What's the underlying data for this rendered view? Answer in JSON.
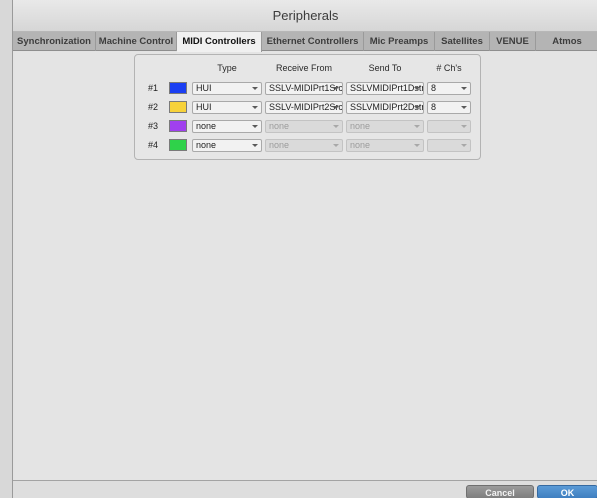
{
  "window": {
    "title": "Peripherals"
  },
  "tabs": [
    {
      "label": "Synchronization"
    },
    {
      "label": "Machine Control"
    },
    {
      "label": "MIDI Controllers"
    },
    {
      "label": "Ethernet Controllers"
    },
    {
      "label": "Mic Preamps"
    },
    {
      "label": "Satellites"
    },
    {
      "label": "VENUE"
    },
    {
      "label": "Atmos"
    }
  ],
  "active_tab": "MIDI Controllers",
  "table": {
    "headers": {
      "type": "Type",
      "receive": "Receive From",
      "send": "Send To",
      "channels": "# Ch's"
    },
    "rows": [
      {
        "num": "#1",
        "color": "#1b3ff2",
        "type": "HUI",
        "receive": "SSLV-MIDIPrt1Src",
        "send": "SSLVMIDIPrt1Dstn",
        "channels": "8"
      },
      {
        "num": "#2",
        "color": "#f7d23a",
        "type": "HUI",
        "receive": "SSLV-MIDIPrt2Src",
        "send": "SSLVMIDIPrt2Dstn",
        "channels": "8"
      },
      {
        "num": "#3",
        "color": "#a040ee",
        "type": "none",
        "receive": "none",
        "send": "none",
        "channels": ""
      },
      {
        "num": "#4",
        "color": "#2fd24a",
        "type": "none",
        "receive": "none",
        "send": "none",
        "channels": ""
      }
    ]
  },
  "footer": {
    "cancel_label": "Cancel",
    "ok_label": "OK"
  }
}
